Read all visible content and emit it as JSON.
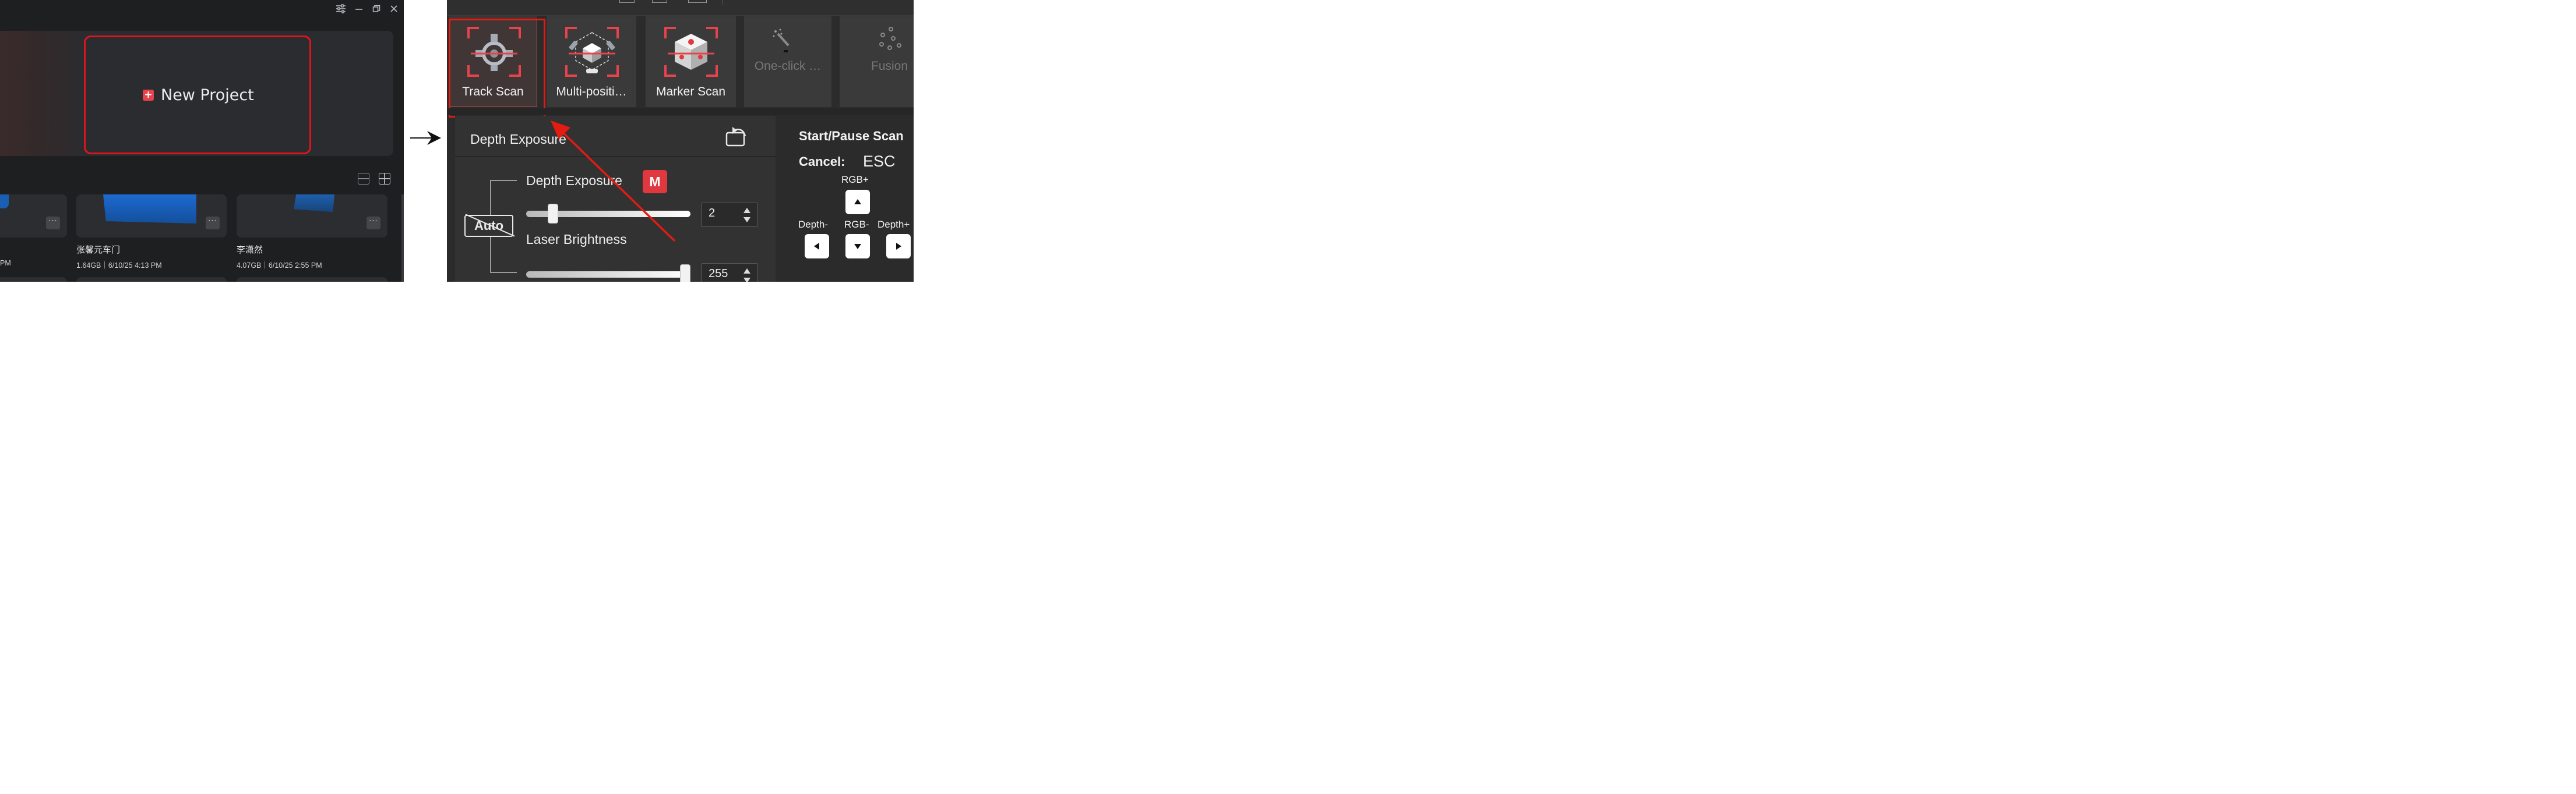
{
  "left_panel": {
    "window_controls": [
      "settings-icon",
      "minimize-icon",
      "restore-icon",
      "close-icon"
    ],
    "new_project_label": "New Project",
    "highlight_color": "#e0141e",
    "projects": [
      {
        "name": "",
        "meta": "PM"
      },
      {
        "name": "张馨元车门",
        "meta": "1.64GB｜6/10/25 4:13 PM"
      },
      {
        "name": "李潇然",
        "meta": "4.07GB｜6/10/25 2:55 PM"
      }
    ],
    "more_label": "···"
  },
  "right_panel": {
    "scan_modes": [
      {
        "label": "Track Scan",
        "enabled": true,
        "selected": true
      },
      {
        "label": "Multi-positi…",
        "enabled": true
      },
      {
        "label": "Marker Scan",
        "enabled": true
      },
      {
        "label": "One-click …",
        "enabled": false
      },
      {
        "label": "Fusion",
        "enabled": false
      }
    ],
    "exposure_panel": {
      "title": "Depth Exposure",
      "auto_label": "Auto",
      "depth_exposure": {
        "label": "Depth Exposure",
        "mode_badge": "M",
        "value": "2",
        "slider_fraction": 0.14
      },
      "laser_brightness": {
        "label": "Laser Brightness",
        "value": "255",
        "slider_fraction": 1.0
      }
    },
    "hotkeys": {
      "start_pause": "Start/Pause Scan",
      "cancel_label": "Cancel:",
      "cancel_key": "ESC",
      "rgb_plus": "RGB+",
      "depth_minus": "Depth-",
      "rgb_minus": "RGB-",
      "depth_plus": "Depth+"
    },
    "accent_color": "#e31b12"
  }
}
